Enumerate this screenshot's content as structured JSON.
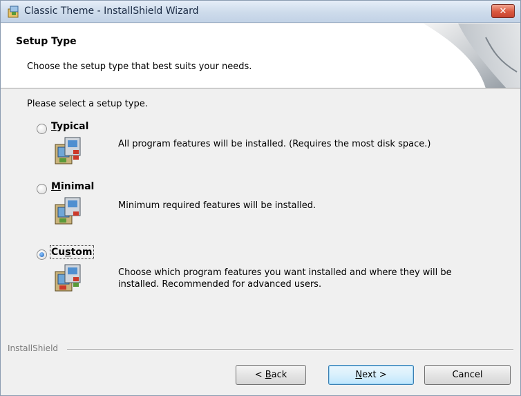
{
  "window": {
    "title": "Classic Theme - InstallShield Wizard",
    "close_glyph": "✕",
    "icon": "installer-icon"
  },
  "header": {
    "title": "Setup Type",
    "subtitle": "Choose the setup type that best suits your needs."
  },
  "content": {
    "prompt": "Please select a setup type.",
    "selected": "Custom",
    "options": [
      {
        "label": "Typical",
        "mnemonic": "T",
        "rest": "ypical",
        "checked": false,
        "description": "All program features will be installed. (Requires the most disk space.)"
      },
      {
        "label": "Minimal",
        "mnemonic": "M",
        "rest": "inimal",
        "checked": false,
        "description": "Minimum required features will be installed."
      },
      {
        "label": "Custom",
        "pre": "Cu",
        "mnemonic": "s",
        "rest": "tom",
        "checked": true,
        "description": "Choose which program features you want installed and where they will be installed. Recommended for advanced users."
      }
    ]
  },
  "footer": {
    "brand": "InstallShield",
    "back": {
      "pre": "< ",
      "mnemonic": "B",
      "rest": "ack"
    },
    "next": {
      "mnemonic": "N",
      "rest": "ext >"
    },
    "cancel": "Cancel"
  },
  "colors": {
    "titlebar": "#cddbeb",
    "close": "#d9583f",
    "dialog_bg": "#f0f0f0",
    "default_button": "#bee6fd"
  }
}
